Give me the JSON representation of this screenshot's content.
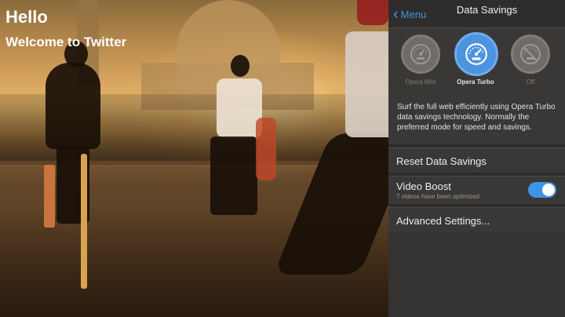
{
  "overlay": {
    "greeting": "Hello",
    "welcome": "Welcome to Twitter"
  },
  "nav": {
    "back_label": "Menu",
    "title": "Data Savings",
    "back_icon": "chevron-left-icon",
    "accent_color": "#3e95e8"
  },
  "modes": [
    {
      "label": "Opera Mini",
      "icon": "speedometer-icon",
      "selected": false
    },
    {
      "label": "Opera Turbo",
      "icon": "speedometer-icon",
      "selected": true
    },
    {
      "label": "Off",
      "icon": "speedometer-off-icon",
      "selected": false
    }
  ],
  "description": "Surf the full web efficiently using Opera Turbo data savings technology. Normally the preferred mode for speed and savings.",
  "settings": {
    "reset_label": "Reset Data Savings",
    "video_boost_label": "Video Boost",
    "video_boost_sub": "7 videos have been optimized",
    "video_boost_on": true,
    "advanced_label": "Advanced Settings..."
  }
}
